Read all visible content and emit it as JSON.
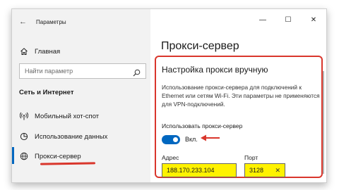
{
  "window": {
    "title": "Параметры",
    "back_glyph": "←",
    "controls": {
      "minimize": "—",
      "maximize": "☐",
      "close": "✕"
    }
  },
  "sidebar": {
    "home_label": "Главная",
    "search_placeholder": "Найти параметр",
    "section_title": "Сеть и Интернет",
    "items": [
      {
        "label": "Мобильный хот-спот",
        "icon": "hotspot-icon",
        "selected": false
      },
      {
        "label": "Использование данных",
        "icon": "data-usage-icon",
        "selected": false
      },
      {
        "label": "Прокси-сервер",
        "icon": "globe-icon",
        "selected": true
      }
    ]
  },
  "main": {
    "page_title": "Прокси-сервер",
    "section_heading": "Настройка прокси вручную",
    "description": "Использование прокси-сервера для подключений к Ethernet или сетям Wi-Fi. Эти параметры не применяются для VPN-подключений.",
    "use_proxy_label": "Использовать прокси-сервер",
    "toggle": {
      "state_label": "Вкл.",
      "on": true
    },
    "address": {
      "label": "Адрес",
      "value": "188.170.233.104"
    },
    "port": {
      "label": "Порт",
      "value": "3128",
      "clear_glyph": "✕"
    }
  },
  "colors": {
    "accent": "#0067c0",
    "highlight_red": "#d9362c",
    "field_highlight": "#fff200",
    "sidebar_bg": "#f2f2f2"
  }
}
